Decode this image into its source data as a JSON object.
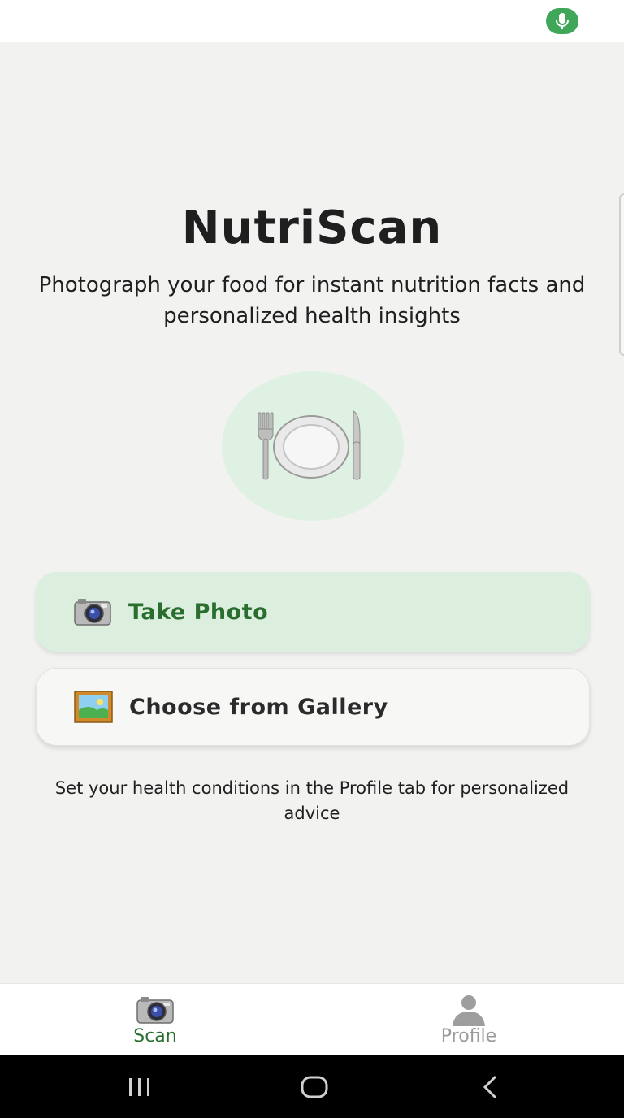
{
  "app": {
    "title": "NutriScan",
    "subtitle": "Photograph your food for instant nutrition facts and personalized health insights"
  },
  "hero": {
    "icon": "fork-knife-plate-icon"
  },
  "actions": {
    "take_photo_label": "Take Photo",
    "take_photo_icon": "camera-icon",
    "gallery_label": "Choose from Gallery",
    "gallery_icon": "framed-picture-icon"
  },
  "hint": "Set your health conditions in the Profile tab for personalized advice",
  "tabs": [
    {
      "label": "Scan",
      "icon": "camera-icon",
      "active": true
    },
    {
      "label": "Profile",
      "icon": "user-silhouette-icon",
      "active": false
    }
  ],
  "colors": {
    "accent": "#2a6e2f",
    "accent_bg": "#dcefdf",
    "hero_bg": "#dff1e3",
    "mic_indicator": "#3fa65a",
    "inactive_tab": "#9a9a9a"
  },
  "system_nav": [
    "recent-apps-icon",
    "home-icon",
    "back-icon"
  ]
}
